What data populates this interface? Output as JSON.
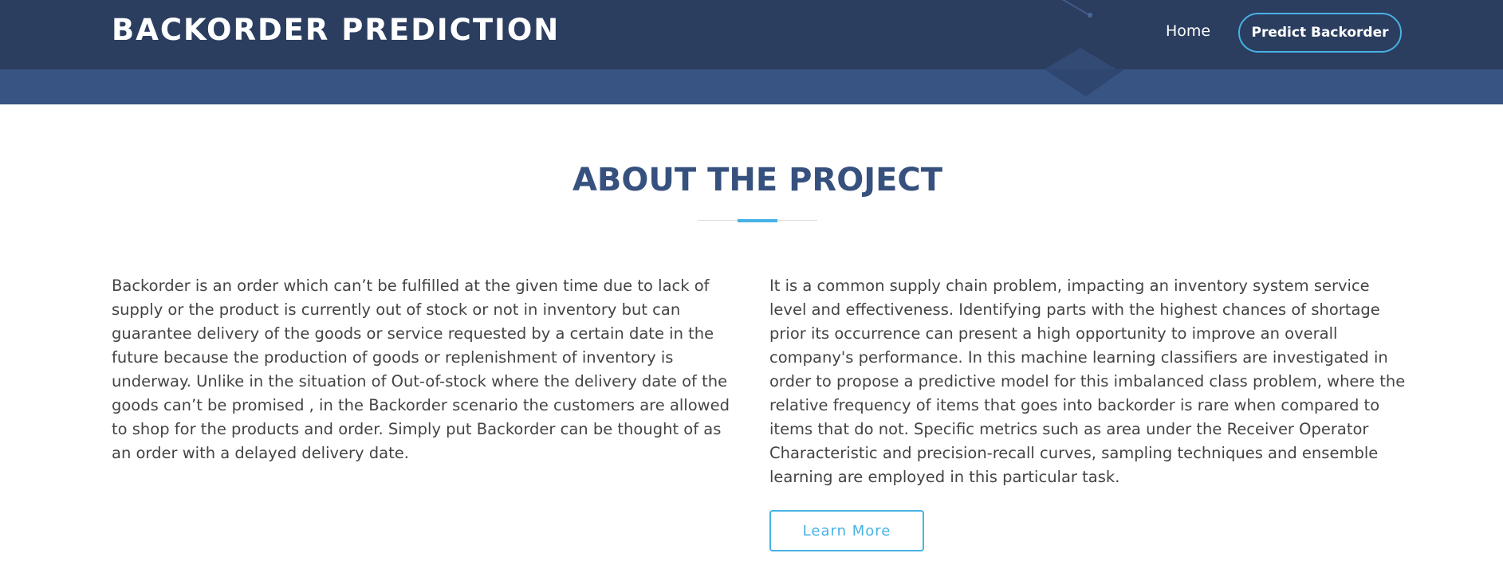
{
  "header": {
    "brand": "BACKORDER PREDICTION",
    "nav": {
      "home_label": "Home",
      "cta_label": "Predict Backorder"
    }
  },
  "about": {
    "title": "ABOUT THE PROJECT",
    "left_paragraph": "Backorder is an order which can’t be fulfilled at the given time due to lack of supply or the product is currently out of stock or not in inventory but can guarantee delivery of the goods or service requested by a certain date in the future because the production of goods or replenishment of inventory is underway. Unlike in the situation of Out-of-stock where the delivery date of the goods can’t be promised , in the Backorder scenario the customers are allowed to shop for the products and order. Simply put Backorder can be thought of as an order with a delayed delivery date.",
    "right_paragraph": "It is a common supply chain problem, impacting an inventory system service level and effectiveness. Identifying parts with the highest chances of shortage prior its occurrence can present a high opportunity to improve an overall company's performance. In this machine learning classifiers are investigated in order to propose a predictive model for this imbalanced class problem, where the relative frequency of items that goes into backorder is rare when compared to items that do not. Specific metrics such as area under the Receiver Operator Characteristic and precision-recall curves, sampling techniques and ensemble learning are employed in this particular task.",
    "learn_more_label": "Learn More"
  },
  "colors": {
    "header_bg": "#2b3e60",
    "band_bg": "#385483",
    "title": "#37517e",
    "accent": "#47b2e4",
    "body_text": "#444444"
  }
}
